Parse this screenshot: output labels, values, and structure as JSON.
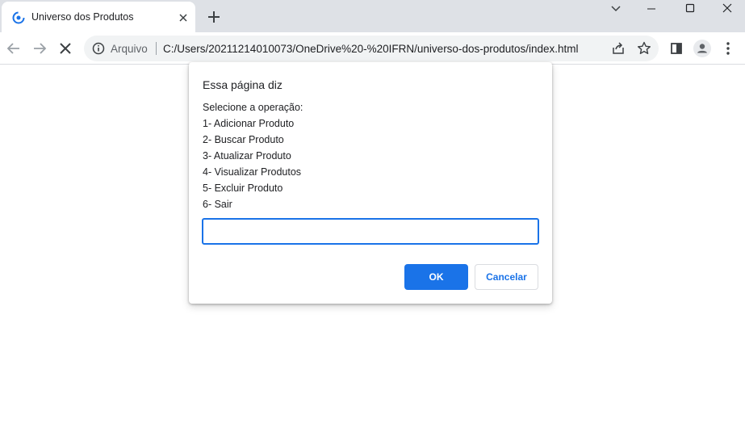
{
  "tab": {
    "title": "Universo dos Produtos",
    "favicon": "loading-favicon-icon"
  },
  "toolbar": {
    "scheme_label": "Arquivo",
    "url": "C:/Users/20211214010073/OneDrive%20-%20IFRN/universo-dos-produtos/index.html"
  },
  "dialog": {
    "title": "Essa página diz",
    "lines": [
      "Selecione a operação:",
      "1- Adicionar Produto",
      "2- Buscar Produto",
      "3- Atualizar Produto",
      "4- Visualizar Produtos",
      "5- Excluir Produto",
      "6- Sair"
    ],
    "input_value": "",
    "ok_label": "OK",
    "cancel_label": "Cancelar"
  },
  "colors": {
    "accent": "#1a73e8",
    "tabstrip": "#dee1e6",
    "omnibox": "#f1f3f4"
  }
}
